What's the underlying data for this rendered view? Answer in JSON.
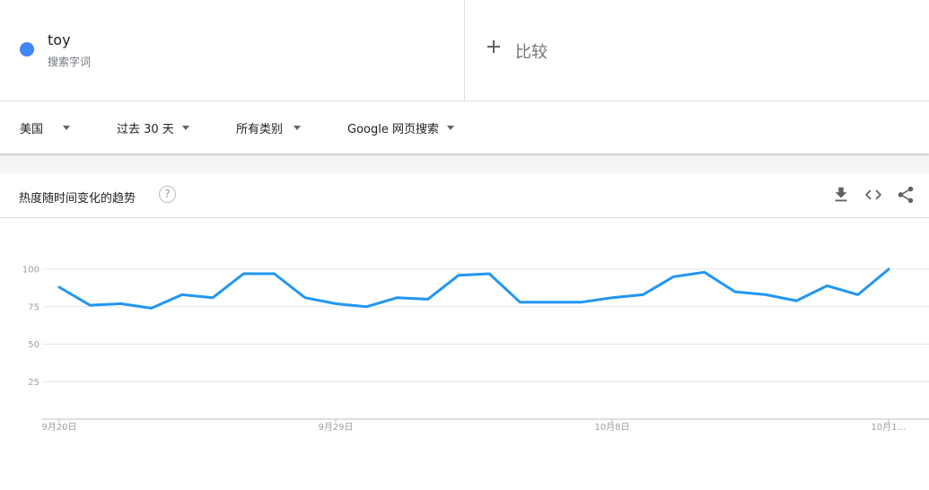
{
  "term": {
    "name": "toy",
    "subtitle": "搜索字词",
    "color": "#4285f4"
  },
  "compare": {
    "label": "比较",
    "icon": "plus-icon"
  },
  "filters": {
    "region": "美国",
    "time": "过去 30 天",
    "category": "所有类别",
    "property": "Google 网页搜索"
  },
  "card": {
    "title": "热度随时间变化的趋势",
    "help_icon": "?",
    "tools": [
      "download-icon",
      "embed-code-icon",
      "share-icon"
    ]
  },
  "chart_data": {
    "type": "line",
    "title": "",
    "xlabel": "",
    "ylabel": "",
    "ylim": [
      0,
      100
    ],
    "yticks": [
      25,
      50,
      75,
      100
    ],
    "grid": true,
    "x_tick_labels": [
      "9月20日",
      "9月29日",
      "10月8日",
      "10月1…"
    ],
    "x_tick_index": [
      0,
      9,
      18,
      27
    ],
    "series": [
      {
        "name": "toy",
        "color": "#2196f3",
        "values": [
          88,
          76,
          77,
          74,
          83,
          81,
          97,
          97,
          81,
          77,
          75,
          81,
          80,
          96,
          97,
          78,
          78,
          78,
          81,
          83,
          95,
          98,
          85,
          83,
          79,
          89,
          83,
          100
        ]
      }
    ]
  }
}
